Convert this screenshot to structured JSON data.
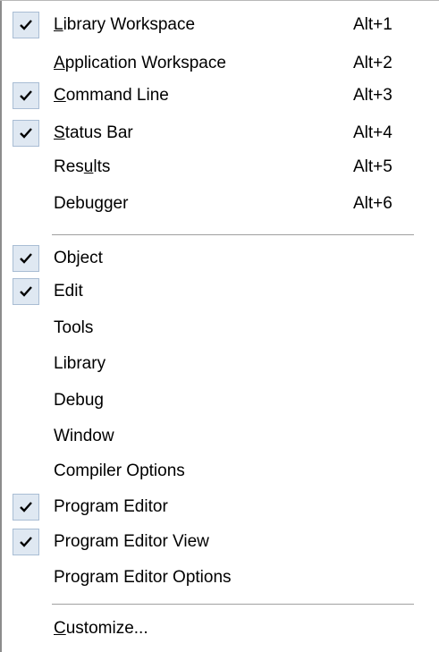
{
  "menu": {
    "items": [
      {
        "pre": "",
        "key": "L",
        "post": "ibrary Workspace",
        "shortcut": "Alt+1",
        "checked": true,
        "name": "menu-item-library-workspace"
      },
      {
        "pre": "",
        "key": "A",
        "post": "pplication Workspace",
        "shortcut": "Alt+2",
        "checked": false,
        "name": "menu-item-application-workspace"
      },
      {
        "pre": "",
        "key": "C",
        "post": "ommand Line",
        "shortcut": "Alt+3",
        "checked": true,
        "name": "menu-item-command-line"
      },
      {
        "pre": "",
        "key": "S",
        "post": "tatus Bar",
        "shortcut": "Alt+4",
        "checked": true,
        "name": "menu-item-status-bar"
      },
      {
        "pre": "Res",
        "key": "u",
        "post": "lts",
        "shortcut": "Alt+5",
        "checked": false,
        "name": "menu-item-results"
      },
      {
        "pre": "Debugger",
        "key": "",
        "post": "",
        "shortcut": "Alt+6",
        "checked": false,
        "name": "menu-item-debugger"
      },
      {
        "pre": "Object",
        "key": "",
        "post": "",
        "shortcut": "",
        "checked": true,
        "name": "menu-item-object"
      },
      {
        "pre": "Edit",
        "key": "",
        "post": "",
        "shortcut": "",
        "checked": true,
        "name": "menu-item-edit"
      },
      {
        "pre": "Tools",
        "key": "",
        "post": "",
        "shortcut": "",
        "checked": false,
        "name": "menu-item-tools"
      },
      {
        "pre": "Library",
        "key": "",
        "post": "",
        "shortcut": "",
        "checked": false,
        "name": "menu-item-library"
      },
      {
        "pre": "Debug",
        "key": "",
        "post": "",
        "shortcut": "",
        "checked": false,
        "name": "menu-item-debug"
      },
      {
        "pre": "Window",
        "key": "",
        "post": "",
        "shortcut": "",
        "checked": false,
        "name": "menu-item-window"
      },
      {
        "pre": "Compiler Options",
        "key": "",
        "post": "",
        "shortcut": "",
        "checked": false,
        "name": "menu-item-compiler-options"
      },
      {
        "pre": "Program Editor",
        "key": "",
        "post": "",
        "shortcut": "",
        "checked": true,
        "name": "menu-item-program-editor"
      },
      {
        "pre": "Program Editor View",
        "key": "",
        "post": "",
        "shortcut": "",
        "checked": true,
        "name": "menu-item-program-editor-view"
      },
      {
        "pre": "Program Editor Options",
        "key": "",
        "post": "",
        "shortcut": "",
        "checked": false,
        "name": "menu-item-program-editor-options"
      },
      {
        "pre": "",
        "key": "C",
        "post": "ustomize...",
        "shortcut": "",
        "checked": false,
        "name": "menu-item-customize"
      }
    ]
  },
  "icons": {
    "check": "checkmark-icon"
  },
  "colors": {
    "check_background": "#dfe8f2",
    "check_border": "#a9bdd4",
    "separator": "#a0a0a0"
  }
}
